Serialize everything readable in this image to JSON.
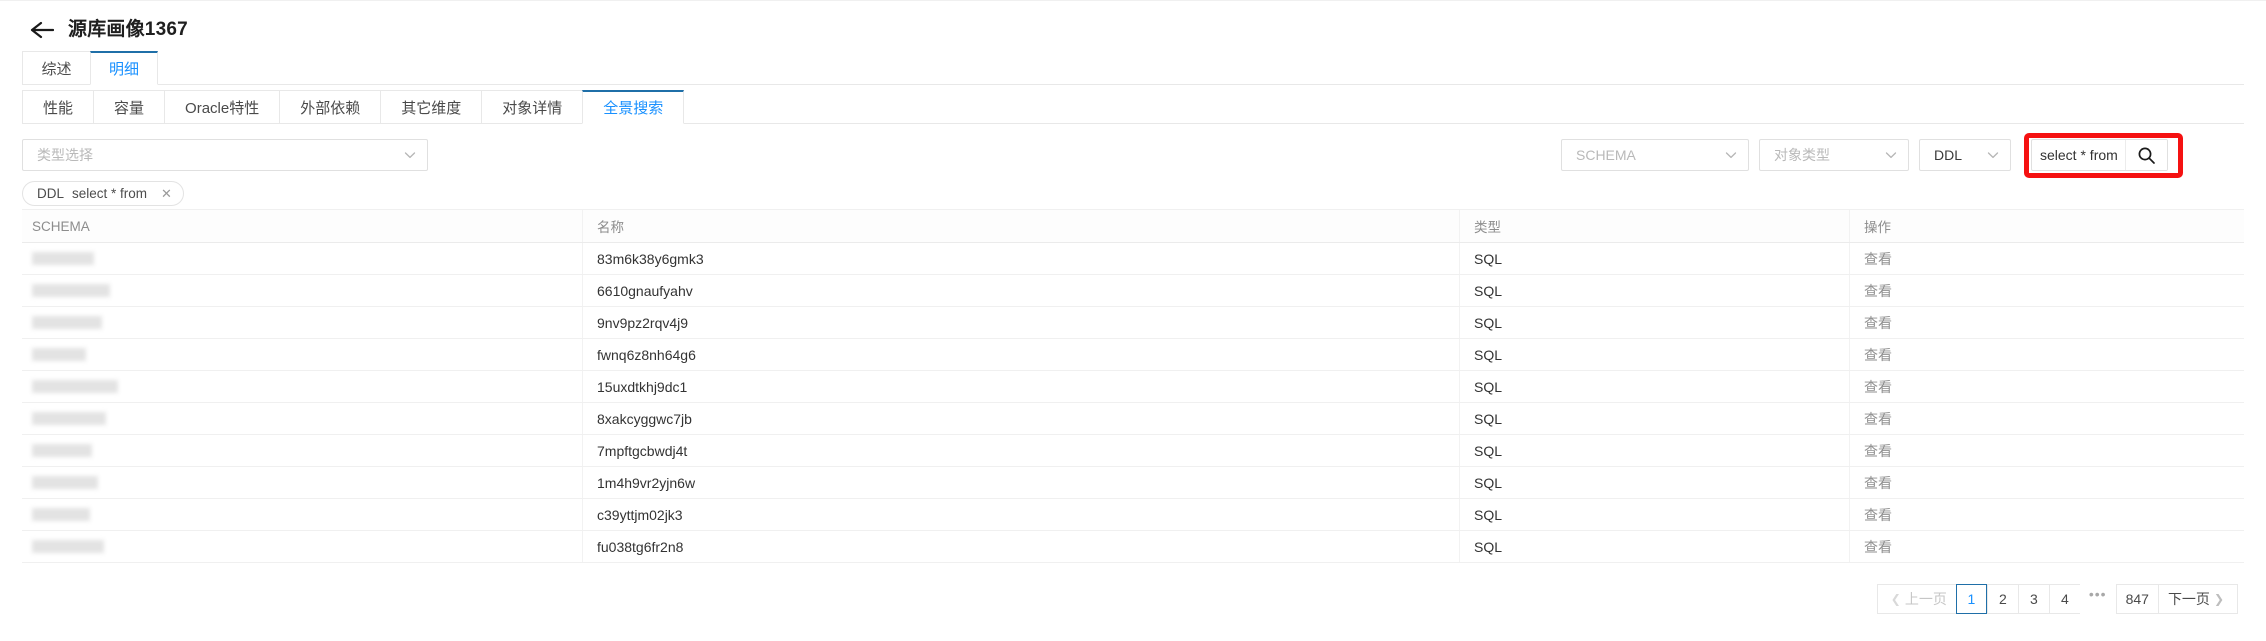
{
  "header": {
    "back_icon": "arrow-left-icon",
    "title": "源库画像1367"
  },
  "tabs_primary": [
    {
      "label": "综述",
      "active": false
    },
    {
      "label": "明细",
      "active": true
    }
  ],
  "tabs_secondary": [
    {
      "label": "性能",
      "active": false
    },
    {
      "label": "容量",
      "active": false
    },
    {
      "label": "Oracle特性",
      "active": false
    },
    {
      "label": "外部依赖",
      "active": false
    },
    {
      "label": "其它维度",
      "active": false
    },
    {
      "label": "对象详情",
      "active": false
    },
    {
      "label": "全景搜索",
      "active": true
    }
  ],
  "filters": {
    "type_select_placeholder": "类型选择",
    "schema_select_placeholder": "SCHEMA",
    "objtype_select_placeholder": "对象类型",
    "ddl_select_value": "DDL",
    "search_value": "select * from",
    "search_placeholder": "",
    "search_icon": "search-icon",
    "chevron_icon": "chevron-down-icon",
    "highlight_color": "#f51111"
  },
  "chips": [
    {
      "key": "DDL",
      "value": "select * from",
      "close": "✕"
    }
  ],
  "table": {
    "columns": [
      "SCHEMA",
      "名称",
      "类型",
      "操作"
    ],
    "rows": [
      {
        "schema": "",
        "name": "83m6k38y6gmk3",
        "type": "SQL",
        "action": "查看"
      },
      {
        "schema": "",
        "name": "6610gnaufyahv",
        "type": "SQL",
        "action": "查看"
      },
      {
        "schema": "",
        "name": "9nv9pz2rqv4j9",
        "type": "SQL",
        "action": "查看"
      },
      {
        "schema": "",
        "name": "fwnq6z8nh64g6",
        "type": "SQL",
        "action": "查看"
      },
      {
        "schema": "",
        "name": "15uxdtkhj9dc1",
        "type": "SQL",
        "action": "查看"
      },
      {
        "schema": "",
        "name": "8xakcyggwc7jb",
        "type": "SQL",
        "action": "查看"
      },
      {
        "schema": "",
        "name": "7mpftgcbwdj4t",
        "type": "SQL",
        "action": "查看"
      },
      {
        "schema": "",
        "name": "1m4h9vr2yjn6w",
        "type": "SQL",
        "action": "查看"
      },
      {
        "schema": "",
        "name": "c39yttjm02jk3",
        "type": "SQL",
        "action": "查看"
      },
      {
        "schema": "",
        "name": "fu038tg6fr2n8",
        "type": "SQL",
        "action": "查看"
      }
    ]
  },
  "pagination": {
    "prev_label": "上一页",
    "next_label": "下一页",
    "pages": [
      "1",
      "2",
      "3",
      "4"
    ],
    "ellipsis": "•••",
    "last_page": "847",
    "current": "1"
  }
}
